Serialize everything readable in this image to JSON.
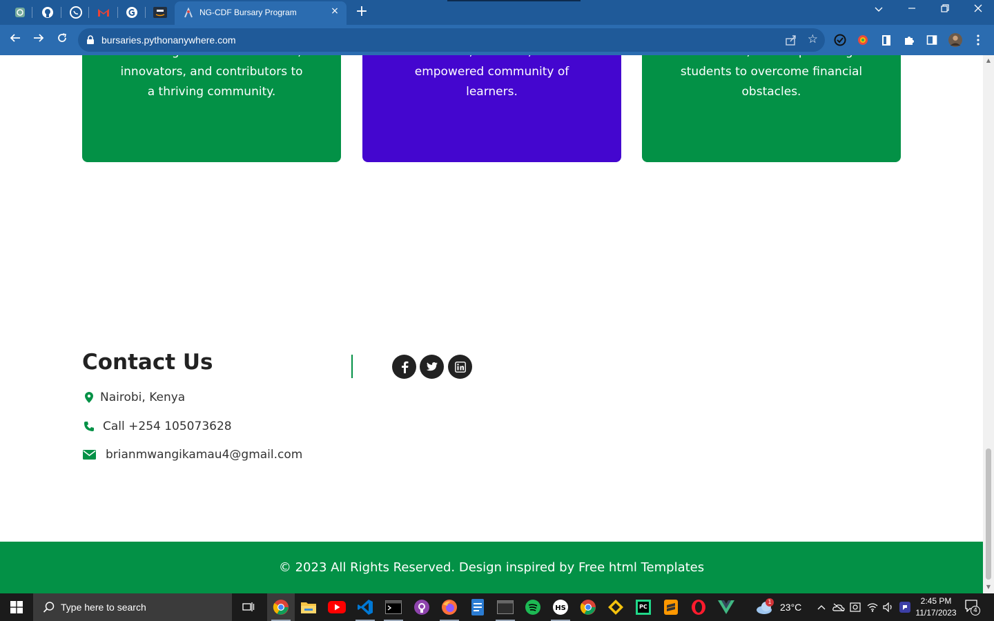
{
  "browser": {
    "tab_title": "NG-CDF Bursary Program",
    "url": "bursaries.pythonanywhere.com",
    "new_tab_symbol": "+",
    "close_tab_symbol": "×",
    "pinned_tabs": [
      "chatgpt-icon",
      "github-icon",
      "whatsapp-icon",
      "gmail-icon",
      "grammarly-icon",
      "aws-icon"
    ],
    "extensions": [
      "check-circle-icon",
      "color-picker-icon",
      "document-icon",
      "puzzle-icon",
      "sidebar-icon",
      "profile-avatar",
      "menu-dots-icon"
    ]
  },
  "cards": [
    {
      "color": "#039146",
      "lines": [
        "a future generation of leaders,",
        "innovators, and contributors to",
        "a thriving community."
      ]
    },
    {
      "color": "#4406cf",
      "lines": [
        "diverse, inclusive, and",
        "empowered community of",
        "learners."
      ]
    },
    {
      "color": "#039146",
      "lines": [
        "resources, and empowering",
        "students to overcome financial",
        "obstacles."
      ]
    }
  ],
  "contact": {
    "title": "Contact Us",
    "location": "Nairobi, Kenya",
    "phone": "Call +254 105073628",
    "email": "brianmwangikamau4@gmail.com"
  },
  "social": [
    "facebook-icon",
    "twitter-icon",
    "linkedin-icon"
  ],
  "footer": {
    "text": "© 2023 All Rights Reserved. Design inspired by Free html Templates"
  },
  "taskbar": {
    "search_placeholder": "Type here to search",
    "weather": "23°C",
    "weather_badge": "1",
    "time": "2:45 PM",
    "date": "11/17/2023",
    "notification_count": "4"
  },
  "colors": {
    "accent_green": "#039146",
    "accent_purple": "#4406cf",
    "chrome_blue": "#2b6cb0"
  }
}
